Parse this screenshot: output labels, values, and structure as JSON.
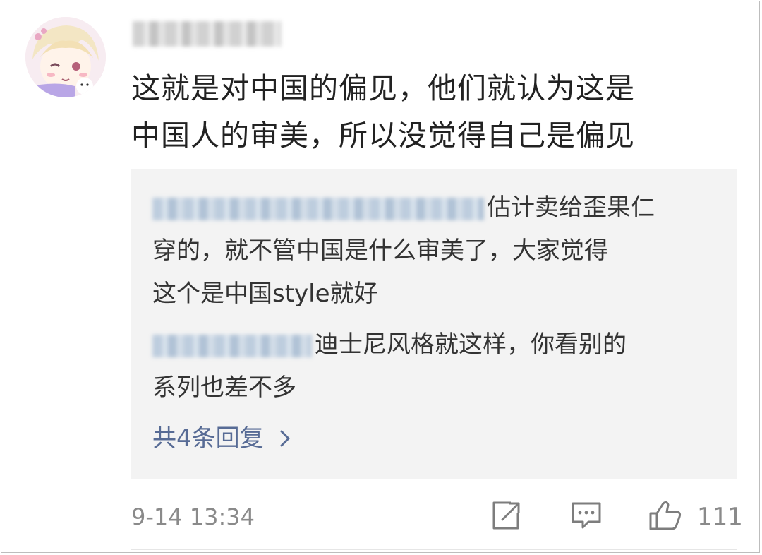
{
  "comment": {
    "text_line1": "这就是对中国的偏见，他们就认为这是",
    "text_line2": "中国人的审美，所以没觉得自己是偏见",
    "time": "9-14 13:34",
    "like_count": "111"
  },
  "replies": [
    {
      "line1": "估计卖给歪果仁",
      "line2": "穿的，就不管中国是什么审美了，大家觉得",
      "line3": "这个是中国style就好"
    },
    {
      "line1": "迪士尼风格就这样，你看别的",
      "line2": "系列也差不多"
    }
  ],
  "more_replies_label": "共4条回复",
  "icons": {
    "share": "share-edit-icon",
    "comment": "comment-bubble-icon",
    "like": "thumbs-up-icon",
    "more": "chevron-right-icon"
  },
  "colors": {
    "link": "#576b95",
    "text": "#222222",
    "muted": "#8a8a8a",
    "reply_bg": "#f3f3f3"
  }
}
